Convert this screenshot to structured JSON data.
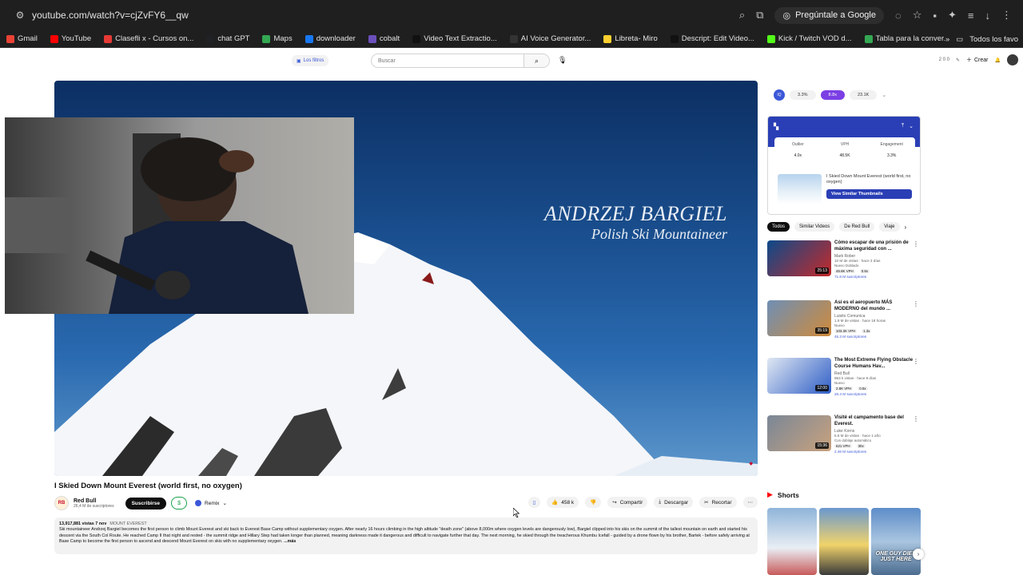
{
  "browser": {
    "url": "youtube.com/watch?v=cjZvFY6__qw",
    "ask_google": "Pregúntale a Google",
    "bookmarks": [
      {
        "label": "Gmail",
        "color": "#ea4335"
      },
      {
        "label": "YouTube",
        "color": "#ff0000"
      },
      {
        "label": "Clasefli x - Cursos on...",
        "color": "#e53935"
      },
      {
        "label": "chat GPT",
        "color": "#202124"
      },
      {
        "label": "Maps",
        "color": "#34a853"
      },
      {
        "label": "downloader",
        "color": "#1877f2"
      },
      {
        "label": "cobalt",
        "color": "#6b4fbb"
      },
      {
        "label": "Video Text Extractio...",
        "color": "#111111"
      },
      {
        "label": "AI Voice Generator...",
        "color": "#333333"
      },
      {
        "label": "Libreta- Miro",
        "color": "#ffd02f"
      },
      {
        "label": "Descript: Edit Video...",
        "color": "#111111"
      },
      {
        "label": "Kick / Twitch VOD d...",
        "color": "#53fc18"
      },
      {
        "label": "Tabla para la conver...",
        "color": "#34a853"
      }
    ],
    "all_bookmarks": "Todos los favo"
  },
  "yt_header": {
    "filter_label": "Los filtros",
    "search_placeholder": "Buscar",
    "create_label": "Crear",
    "counts": "2  0  0"
  },
  "video": {
    "overlay_name": "ANDRZEJ BARGIEL",
    "overlay_role": "Polish Ski Mountaineer",
    "title": "I Skied Down Mount Everest (world first, no oxygen)",
    "channel_name": "Red Bull",
    "channel_subs": "26,4 M de suscriptores",
    "subscribe_label": "Suscribirse",
    "remix_label": "Remix",
    "likes": "458 k",
    "share_label": "Compartir",
    "download_label": "Descargar",
    "clip_label": "Recortar",
    "views_line": "13,917,881 vistas  7 nov",
    "hashtag": "MOUNT EVEREST",
    "description": "Ski mountaineer Andrzej Bargiel becomes the first person to climb Mount Everest and ski back to Everest Base Camp without supplementary oxygen. After nearly 16 hours climbing in the high altitude \"death zone\" (above 8,000m where oxygen levels are dangerously low), Bargiel clipped into his skis on the summit of the tallest mountain on earth and started his descent via the South Col Route. He reached Camp II that night and rested - the summit ridge and Hillary Step had taken longer than planned, meaning darkness made it dangerous and difficult to navigate further that day. The next morning, he skied through the treacherous Khumbu Icefall - guided by a drone flown by his brother, Bartek - before safely arriving at Base Camp to become the first person to ascend and descend Mount Everest on skis with no supplementary oxygen.",
    "more_label": "...más"
  },
  "vidiq": {
    "pills": [
      "3.3%",
      "8.8x",
      "23.1K"
    ],
    "stats": [
      {
        "label": "Outlier",
        "value": "4.0x"
      },
      {
        "label": "VPH",
        "value": "48.5K"
      },
      {
        "label": "Engagement",
        "value": "3.3%"
      }
    ],
    "card_title": "I Skied Down Mount Everest (world first, no oxygen)",
    "card_button": "View Similar Thumbnails"
  },
  "chips": [
    "Todos",
    "Similar Videos",
    "De Red Bull",
    "Viaje"
  ],
  "related": [
    {
      "title": "Cómo escapar de una prisión de máxima seguridad con ...",
      "by": "Mark Rober",
      "views": "10 M de vistas · hace 3 días",
      "tags": "Nuevo  Doblado",
      "stat1": "45.8K VPH",
      "stat2": "0.8x",
      "subs": "71.8 M suscriptores",
      "duration": "25:13",
      "c1": "#0c4a8a",
      "c2": "#c52a2a"
    },
    {
      "title": "Así es el aeropuerto MÁS MODERNO del mundo ...",
      "by": "Luisito Comunica",
      "views": "1.9 M de vistas · hace 18 horas",
      "tags": "Nuevo",
      "stat1": "103.3K VPH",
      "stat2": "1.3x",
      "subs": "45.3 M suscriptores",
      "duration": "35:19",
      "c1": "#6e8fb5",
      "c2": "#d08a3a"
    },
    {
      "title": "The Most Extreme Flying Obstacle Course Humans Hav...",
      "by": "Red Bull",
      "views": "953 k vistas · hace 8 días",
      "tags": "Nuevo",
      "stat1": "2.8K VPH",
      "stat2": "0.8x",
      "subs": "26.4 M suscriptores",
      "duration": "12:00",
      "c1": "#dfe7f2",
      "c2": "#2f5ec6"
    },
    {
      "title": "Visité el campamento base del Everest.",
      "by": "Luke Korns",
      "views": "5.8 M de vistas · hace 1 año",
      "tags": "Con doblaje automático",
      "stat1": "621 VPH",
      "stat2": "30x",
      "subs": "2.46 M suscriptores",
      "duration": "15:36",
      "c1": "#7a8797",
      "c2": "#c9a27e"
    }
  ],
  "shorts": {
    "label": "Shorts",
    "captions": [
      "",
      "",
      "ONE GUY DIED JUST HERE"
    ]
  }
}
